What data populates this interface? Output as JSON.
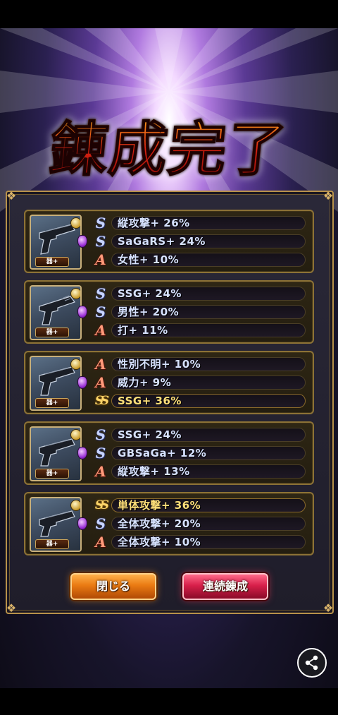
{
  "title": "錬成完了",
  "weapon_tag": "器+",
  "cards": [
    {
      "stats": [
        {
          "grade": "S",
          "text": "縦攻撃+ 26%"
        },
        {
          "grade": "S",
          "text": "SaGaRS+ 24%"
        },
        {
          "grade": "A",
          "text": "女性+ 10%"
        }
      ]
    },
    {
      "stats": [
        {
          "grade": "S",
          "text": "SSG+ 24%"
        },
        {
          "grade": "S",
          "text": "男性+ 20%"
        },
        {
          "grade": "A",
          "text": "打+ 11%"
        }
      ]
    },
    {
      "stats": [
        {
          "grade": "A",
          "text": "性別不明+ 10%"
        },
        {
          "grade": "A",
          "text": "威力+ 9%"
        },
        {
          "grade": "SS",
          "text": "SSG+ 36%"
        }
      ]
    },
    {
      "stats": [
        {
          "grade": "S",
          "text": "SSG+ 24%"
        },
        {
          "grade": "S",
          "text": "GBSaGa+ 12%"
        },
        {
          "grade": "A",
          "text": "縦攻撃+ 13%"
        }
      ]
    },
    {
      "stats": [
        {
          "grade": "SS",
          "text": "単体攻撃+ 36%"
        },
        {
          "grade": "S",
          "text": "全体攻撃+ 20%"
        },
        {
          "grade": "A",
          "text": "全体攻撃+ 10%"
        }
      ]
    }
  ],
  "buttons": {
    "close": "閉じる",
    "continue": "連続錬成"
  },
  "icons": {
    "grade_s": "S",
    "grade_a": "A",
    "grade_ss": "SS",
    "share": "share-icon"
  }
}
